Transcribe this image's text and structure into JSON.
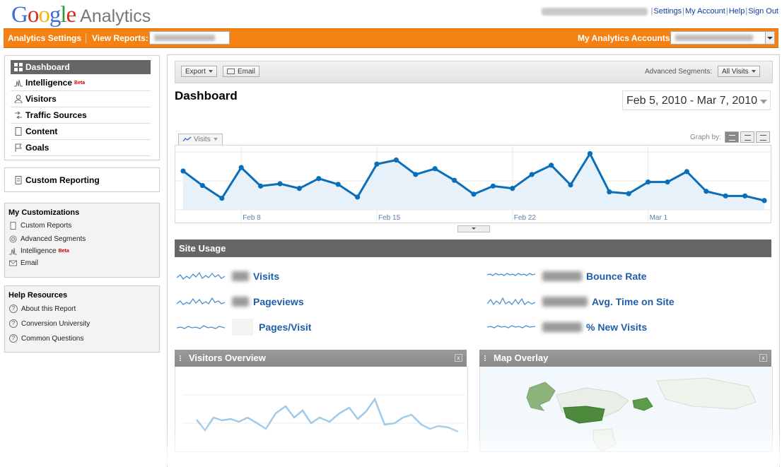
{
  "header": {
    "logo_google": "Google",
    "logo_product": "Analytics",
    "links": [
      "Settings",
      "My Account",
      "Help",
      "Sign Out"
    ]
  },
  "orange_bar": {
    "settings_label": "Analytics Settings",
    "view_reports_label": "View Reports:",
    "accounts_label": "My Analytics Accounts:"
  },
  "nav": {
    "items": [
      {
        "label": "Dashboard",
        "icon": "dashboard-icon",
        "active": true
      },
      {
        "label": "Intelligence",
        "icon": "intelligence-icon",
        "badge": "Beta"
      },
      {
        "label": "Visitors",
        "icon": "visitors-icon"
      },
      {
        "label": "Traffic Sources",
        "icon": "traffic-sources-icon"
      },
      {
        "label": "Content",
        "icon": "content-icon"
      },
      {
        "label": "Goals",
        "icon": "goals-icon"
      }
    ],
    "custom_reporting": "Custom Reporting"
  },
  "my_customizations": {
    "title": "My Customizations",
    "items": [
      {
        "label": "Custom Reports",
        "icon": "document-icon"
      },
      {
        "label": "Advanced Segments",
        "icon": "segments-icon"
      },
      {
        "label": "Intelligence",
        "icon": "intelligence-icon",
        "badge": "Beta"
      },
      {
        "label": "Email",
        "icon": "email-icon"
      }
    ]
  },
  "help_resources": {
    "title": "Help Resources",
    "items": [
      "About this Report",
      "Conversion University",
      "Common Questions"
    ]
  },
  "toolbar": {
    "export_label": "Export",
    "email_label": "Email",
    "segments_label": "Advanced Segments:",
    "segments_value": "All Visits"
  },
  "dashboard": {
    "title": "Dashboard",
    "date_range": "Feb 5, 2010 - Mar 7, 2010",
    "metric_selector": "Visits",
    "graph_by_label": "Graph by:"
  },
  "chart_data": {
    "type": "area",
    "series": [
      {
        "values": [
          0.67,
          0.42,
          0.2,
          0.73,
          0.41,
          0.45,
          0.37,
          0.54,
          0.44,
          0.22,
          0.79,
          0.86,
          0.61,
          0.71,
          0.51,
          0.27,
          0.41,
          0.37,
          0.61,
          0.77,
          0.43,
          0.97,
          0.31,
          0.28,
          0.48,
          0.48,
          0.66,
          0.32,
          0.24,
          0.24,
          0.16
        ]
      }
    ],
    "x_tick_labels": [
      "Feb 8",
      "Feb 15",
      "Feb 22",
      "Mar 1"
    ],
    "x_tick_indices": [
      3,
      10,
      17,
      24
    ],
    "color": "#0b6eb8",
    "fill": "#e6f1fa",
    "grid": true
  },
  "site_usage": {
    "title": "Site Usage",
    "metrics": [
      {
        "label": "Visits"
      },
      {
        "label": "Pageviews"
      },
      {
        "label": "Pages/Visit"
      },
      {
        "label": "Bounce Rate"
      },
      {
        "label": "Avg. Time on Site"
      },
      {
        "label": "% New Visits"
      }
    ]
  },
  "widgets": {
    "visitors_overview": "Visitors Overview",
    "map_overlay": "Map Overlay",
    "close_glyph": "x"
  }
}
